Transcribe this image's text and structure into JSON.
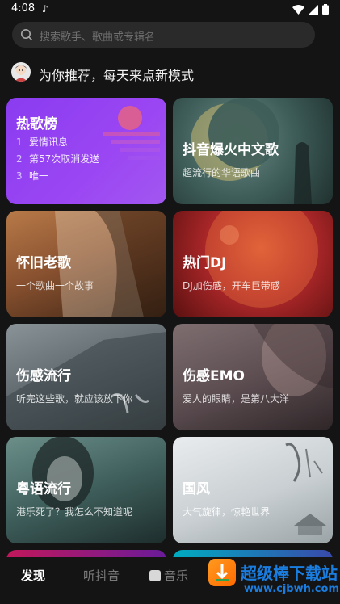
{
  "status": {
    "time": "4:08",
    "music_note": "♪"
  },
  "search": {
    "placeholder": "搜索歌手、歌曲或专辑名"
  },
  "recommend": {
    "text": "为你推荐，每天来点新模式"
  },
  "cards": {
    "hot": {
      "title": "热歌榜",
      "rows": [
        {
          "num": "1",
          "name": "爱情讯息"
        },
        {
          "num": "2",
          "name": "第57次取消发送"
        },
        {
          "num": "3",
          "name": "唯一"
        }
      ]
    },
    "douyin": {
      "title": "抖音爆火中文歌",
      "subtitle": "超流行的华语歌曲"
    },
    "old": {
      "title": "怀旧老歌",
      "subtitle": "一个歌曲一个故事"
    },
    "dj": {
      "title": "热门DJ",
      "subtitle": "DJ加伤感，开车巨带感"
    },
    "sad": {
      "title": "伤感流行",
      "subtitle": "听完这些歌，就应该放下你"
    },
    "emo": {
      "title": "伤感EMO",
      "subtitle": "爱人的眼睛，是第八大洋"
    },
    "yue": {
      "title": "粤语流行",
      "subtitle": "港乐死了？我怎么不知道呢"
    },
    "guofeng": {
      "title": "国风",
      "subtitle": "大气旋律，惊艳世界"
    }
  },
  "tabs": {
    "discover": "发现",
    "douyin": "听抖音",
    "music": "音乐"
  },
  "watermark": {
    "name": "超级棒下载站",
    "url": "www.cjbwh.com"
  },
  "colors": {
    "hot_card": "#9b46f3",
    "background": "#141414",
    "watermark": "#1a7de0"
  }
}
